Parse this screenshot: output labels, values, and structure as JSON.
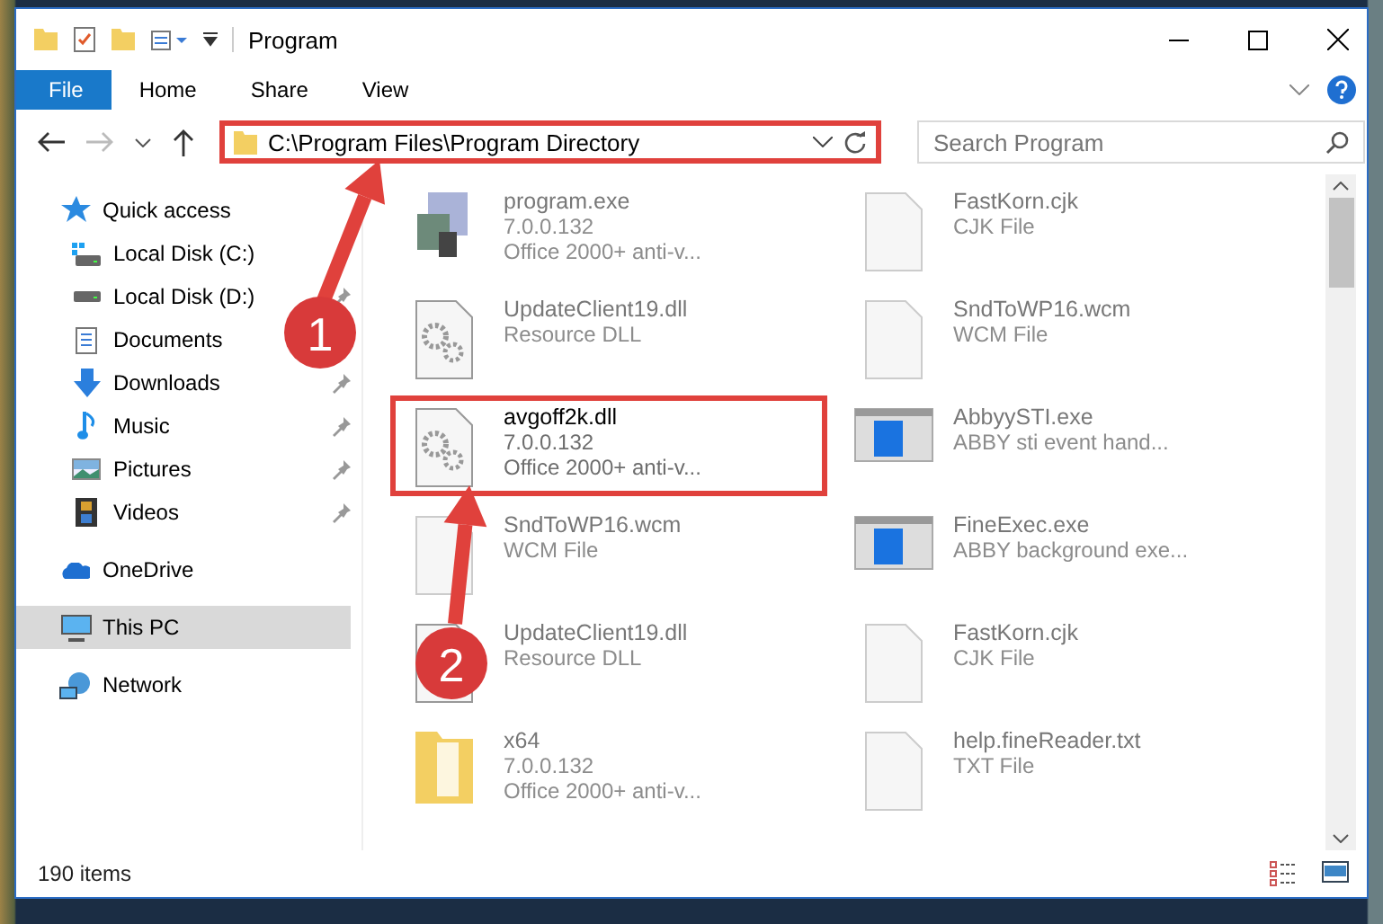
{
  "window": {
    "title": "Program"
  },
  "ribbon": {
    "tabs": [
      {
        "label": "File",
        "kind": "file"
      },
      {
        "label": "Home",
        "kind": "tab"
      },
      {
        "label": "Share",
        "kind": "tab"
      },
      {
        "label": "View",
        "kind": "tab"
      }
    ]
  },
  "address": {
    "path": "C:\\Program Files\\Program Directory",
    "highlighted": true
  },
  "search": {
    "placeholder": "Search Program"
  },
  "sidebar": {
    "items": [
      {
        "label": "Quick access",
        "kind": "star",
        "selected": false,
        "children": [
          {
            "label": "Local Disk (C:)",
            "kind": "disk-c",
            "selected": false,
            "pinned": false
          },
          {
            "label": "Local Disk (D:)",
            "kind": "disk",
            "selected": false,
            "pinned": true
          },
          {
            "label": "Documents",
            "kind": "doc",
            "selected": false,
            "pinned": false
          },
          {
            "label": "Downloads",
            "kind": "download",
            "selected": false,
            "pinned": true
          },
          {
            "label": "Music",
            "kind": "music",
            "selected": false,
            "pinned": true
          },
          {
            "label": "Pictures",
            "kind": "pictures",
            "selected": false,
            "pinned": true
          },
          {
            "label": "Videos",
            "kind": "videos",
            "selected": false,
            "pinned": true
          }
        ]
      },
      {
        "label": "OneDrive",
        "kind": "cloud",
        "selected": false
      },
      {
        "label": "This PC",
        "kind": "pc",
        "selected": true
      },
      {
        "label": "Network",
        "kind": "network",
        "selected": false
      }
    ]
  },
  "files": [
    {
      "name": "program.exe",
      "details": [
        "7.0.0.132",
        "Office 2000+ anti-v..."
      ],
      "kind": "exe",
      "blurred": true,
      "highlighted": false
    },
    {
      "name": "FastKorn.cjk",
      "details": [
        "CJK File"
      ],
      "kind": "blank",
      "blurred": true,
      "highlighted": false
    },
    {
      "name": "UpdateClient19.dll",
      "details": [
        "Resource DLL"
      ],
      "kind": "dll",
      "blurred": true,
      "highlighted": false
    },
    {
      "name": "SndToWP16.wcm",
      "details": [
        "WCM File"
      ],
      "kind": "blank",
      "blurred": true,
      "highlighted": false
    },
    {
      "name": "avgoff2k.dll",
      "details": [
        "7.0.0.132",
        "Office 2000+ anti-v..."
      ],
      "kind": "dll",
      "blurred": false,
      "highlighted": true
    },
    {
      "name": "AbbyySTI.exe",
      "details": [
        "ABBY sti event hand..."
      ],
      "kind": "app",
      "blurred": true,
      "highlighted": false
    },
    {
      "name": "SndToWP16.wcm",
      "details": [
        "WCM File"
      ],
      "kind": "blank",
      "blurred": true,
      "highlighted": false
    },
    {
      "name": "FineExec.exe",
      "details": [
        "ABBY background exe..."
      ],
      "kind": "app",
      "blurred": true,
      "highlighted": false
    },
    {
      "name": "UpdateClient19.dll",
      "details": [
        "Resource DLL"
      ],
      "kind": "dll",
      "blurred": true,
      "highlighted": false
    },
    {
      "name": "FastKorn.cjk",
      "details": [
        "CJK File"
      ],
      "kind": "blank",
      "blurred": true,
      "highlighted": false
    },
    {
      "name": "x64",
      "details": [
        "7.0.0.132",
        "Office 2000+ anti-v..."
      ],
      "kind": "folder",
      "blurred": true,
      "highlighted": false
    },
    {
      "name": "help.fineReader.txt",
      "details": [
        "TXT File"
      ],
      "kind": "blank",
      "blurred": true,
      "highlighted": false
    }
  ],
  "status_bar": {
    "count": "190 items"
  },
  "callouts": [
    {
      "label": "1"
    },
    {
      "label": "2"
    }
  ]
}
